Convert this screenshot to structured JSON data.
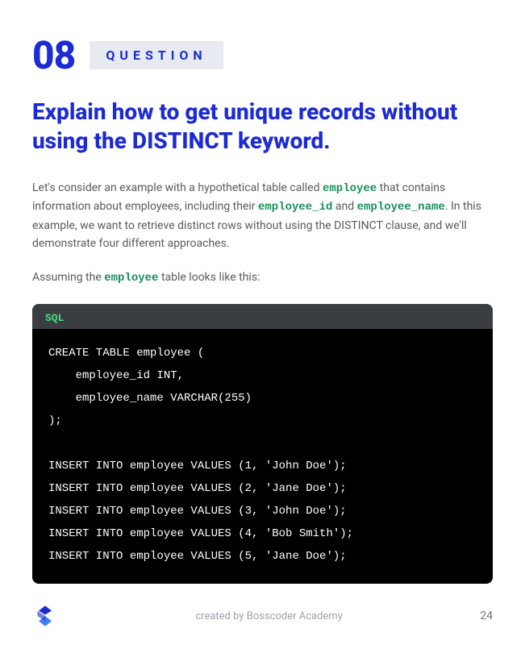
{
  "header": {
    "number": "08",
    "label": "QUESTION"
  },
  "title": "Explain how to get unique records without using the DISTINCT keyword.",
  "paragraph1": {
    "prefix": "Let's consider an example with a hypothetical table called ",
    "code1": "employee",
    "mid1": " that contains information about employees, including their ",
    "code2": "employee_id",
    "mid2": " and ",
    "code3": "employee_name",
    "suffix": ". In this example, we want to retrieve distinct rows without using the DISTINCT clause, and we'll demonstrate four different approaches."
  },
  "paragraph2": {
    "prefix": "Assuming the ",
    "code1": "employee",
    "suffix": " table looks like this:"
  },
  "code": {
    "lang": "SQL",
    "body": "CREATE TABLE employee (\n    employee_id INT,\n    employee_name VARCHAR(255)\n);\n\nINSERT INTO employee VALUES (1, 'John Doe');\nINSERT INTO employee VALUES (2, 'Jane Doe');\nINSERT INTO employee VALUES (3, 'John Doe');\nINSERT INTO employee VALUES (4, 'Bob Smith');\nINSERT INTO employee VALUES (5, 'Jane Doe');"
  },
  "footer": {
    "credit": "created by Bosscoder Academy",
    "page": "24"
  }
}
